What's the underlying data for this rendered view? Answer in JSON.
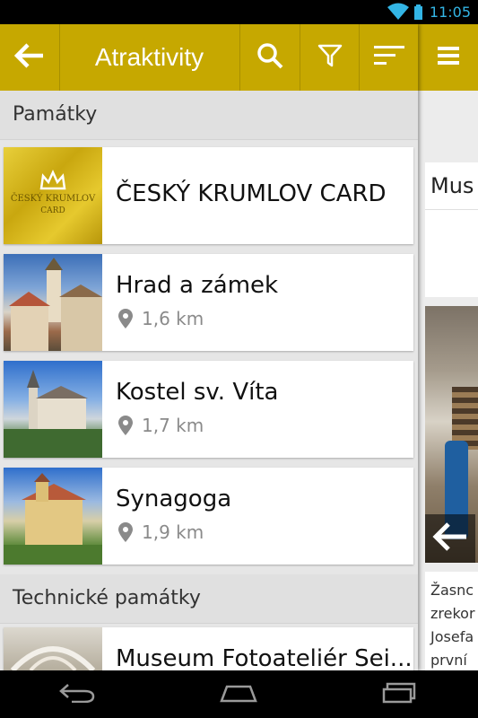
{
  "status": {
    "time": "11:05"
  },
  "appbar": {
    "title": "Atraktivity"
  },
  "sections": [
    {
      "label": "Památky"
    },
    {
      "label": "Technické památky"
    }
  ],
  "items": [
    {
      "title": "ČESKÝ KRUMLOV CARD",
      "distance": ""
    },
    {
      "title": "Hrad a zámek",
      "distance": "1,6 km"
    },
    {
      "title": "Kostel sv. Víta",
      "distance": "1,7 km"
    },
    {
      "title": "Synagoga",
      "distance": "1,9 km"
    },
    {
      "title": "Museum Fotoateliér Sei...",
      "distance": ""
    }
  ],
  "card_logo": {
    "line1": "ČESKÝ KRUMLOV",
    "line2": "CARD"
  },
  "detail": {
    "title_fragment": "Mus",
    "text_lines": [
      "Žasnc",
      "zrekor",
      "Josefa",
      "první "
    ]
  },
  "colors": {
    "appbar": "#c6a800",
    "accent": "#33b5e5"
  }
}
